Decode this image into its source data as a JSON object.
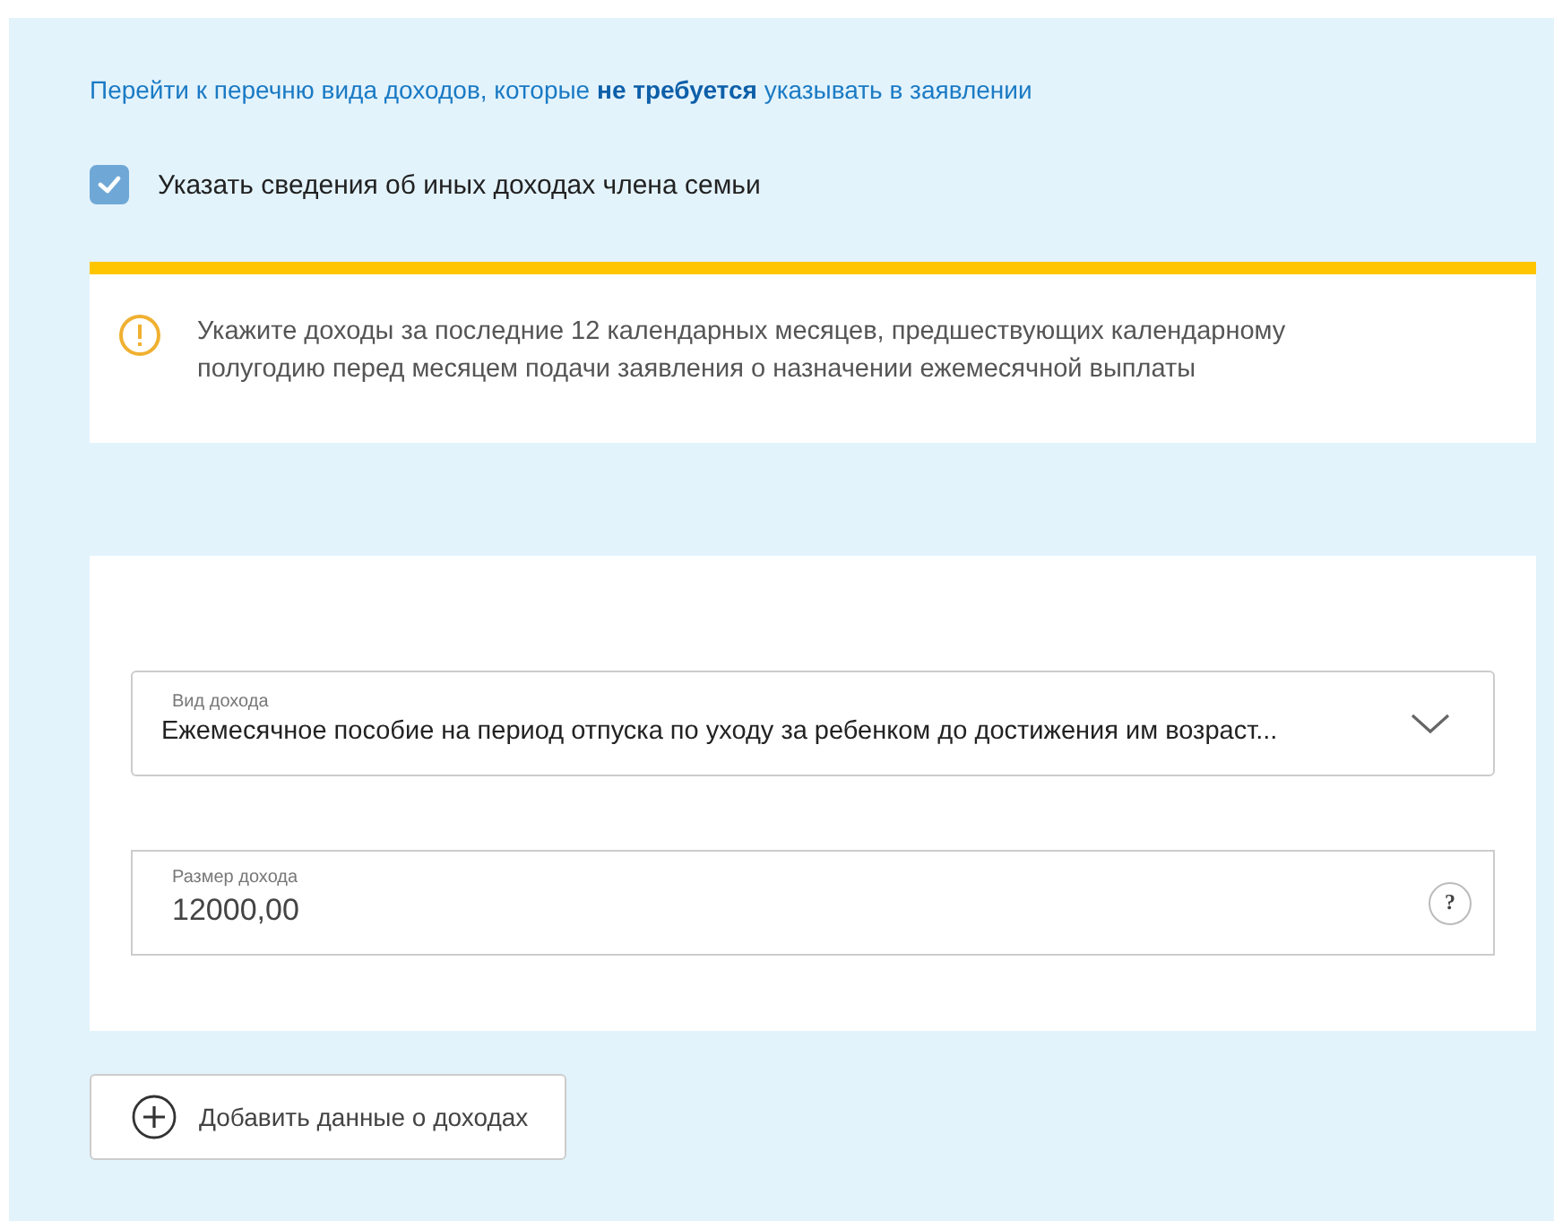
{
  "link": {
    "text": "Перейти к перечню вида доходов, которые **не требуется** указывать в заявлении"
  },
  "checkbox": {
    "label": "Указать сведения об иных доходах члена семьи",
    "checked": true
  },
  "notice": {
    "text": "Укажите доходы за последние 12 календарных месяцев, предшествующих календарному полугодию перед месяцем подачи заявления о назначении ежемесячной выплаты"
  },
  "fields": [
    {
      "kind": "select",
      "label": "Вид дохода",
      "value": "Ежемесячное пособие на период отпуска по уходу за ребенком до достижения им возраст..."
    },
    {
      "kind": "input",
      "label": "Размер дохода",
      "value": "12000,00",
      "help": "?"
    }
  ],
  "add_button": {
    "label": "Добавить данные о доходах"
  }
}
